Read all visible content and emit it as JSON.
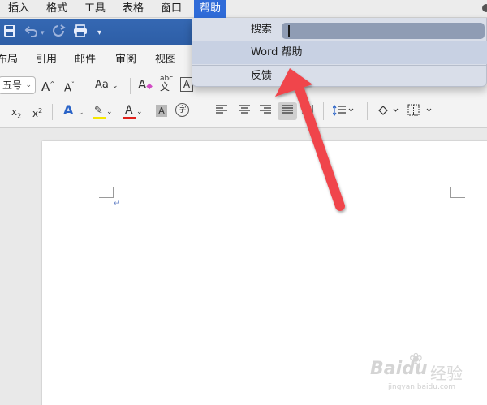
{
  "menubar": {
    "items": [
      "插入",
      "格式",
      "工具",
      "表格",
      "窗口",
      "帮助"
    ],
    "active_item": "帮助"
  },
  "titlebar": {
    "icons": [
      "save-icon",
      "undo-icon",
      "chevron-down-icon",
      "redo-icon",
      "print-icon",
      "customize-icon"
    ]
  },
  "ribbon_tabs": [
    "布局",
    "引用",
    "邮件",
    "审阅",
    "视图"
  ],
  "toolbar": {
    "font_size": "五号",
    "grow_font": "A",
    "shrink_font": "A",
    "change_case": "Aa",
    "clear_format": "A",
    "phonetic": "abc",
    "phonetic_char": "文",
    "char_border": "A",
    "subscript": "x",
    "subscript_mark": "2",
    "superscript": "x",
    "superscript_mark": "2",
    "text_effect": "A",
    "highlight_color": "#f5e600",
    "font_color": "#e0201b",
    "font_color_letter": "A",
    "char_shading": "A",
    "enclose_char": "字"
  },
  "help_menu": {
    "search_label": "搜索",
    "search_value": "",
    "items": [
      "Word 帮助",
      "反馈"
    ]
  },
  "watermark": {
    "brand": "Baidu",
    "suffix": "经验",
    "url": "jingyan.baidu.com"
  },
  "colors": {
    "menu_active": "#2f6bd8",
    "titlebar": "#2d5ea6",
    "arrow": "#f0454b"
  }
}
